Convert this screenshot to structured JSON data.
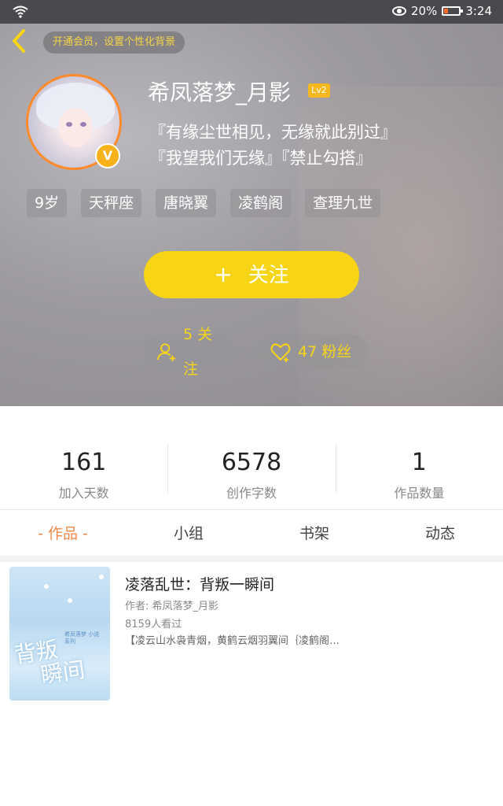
{
  "status_bar": {
    "battery": "20%",
    "time": "3:24"
  },
  "header": {
    "vip_prompt": "开通会员，设置个性化背景",
    "username": "希凤落梦_月影",
    "level": "Lv2",
    "vbadge": "V",
    "signature_line1": "『有缘尘世相见，无缘就此别过』",
    "signature_line2": "『我望我们无缘』『禁止勾搭』",
    "tags": [
      "9岁",
      "天秤座",
      "唐晓翼",
      "凌鹤阁",
      "查理九世"
    ],
    "follow_plus": "+",
    "follow_label": "关注",
    "following": "5 关注",
    "followers": "47 粉丝"
  },
  "counts": [
    {
      "value": "161",
      "label": "加入天数"
    },
    {
      "value": "6578",
      "label": "创作字数"
    },
    {
      "value": "1",
      "label": "作品数量"
    }
  ],
  "tabs": [
    "- 作品 -",
    "小组",
    "书架",
    "动态"
  ],
  "book": {
    "title": "凌落乱世：背叛一瞬间",
    "author": "作者: 希凤落梦_月影",
    "views": "8159人看过",
    "description": "【凌云山水袅青烟，黄鹤云烟羽翼间｛凌鹤阁…",
    "cover_title_1": "背叛",
    "cover_title_2": "瞬间",
    "cover_sub": "希凤落梦 小说系列"
  },
  "colors": {
    "accent": "#f7d516",
    "tab_active": "#f0884a",
    "avatar_border": "#ff8a2a"
  }
}
